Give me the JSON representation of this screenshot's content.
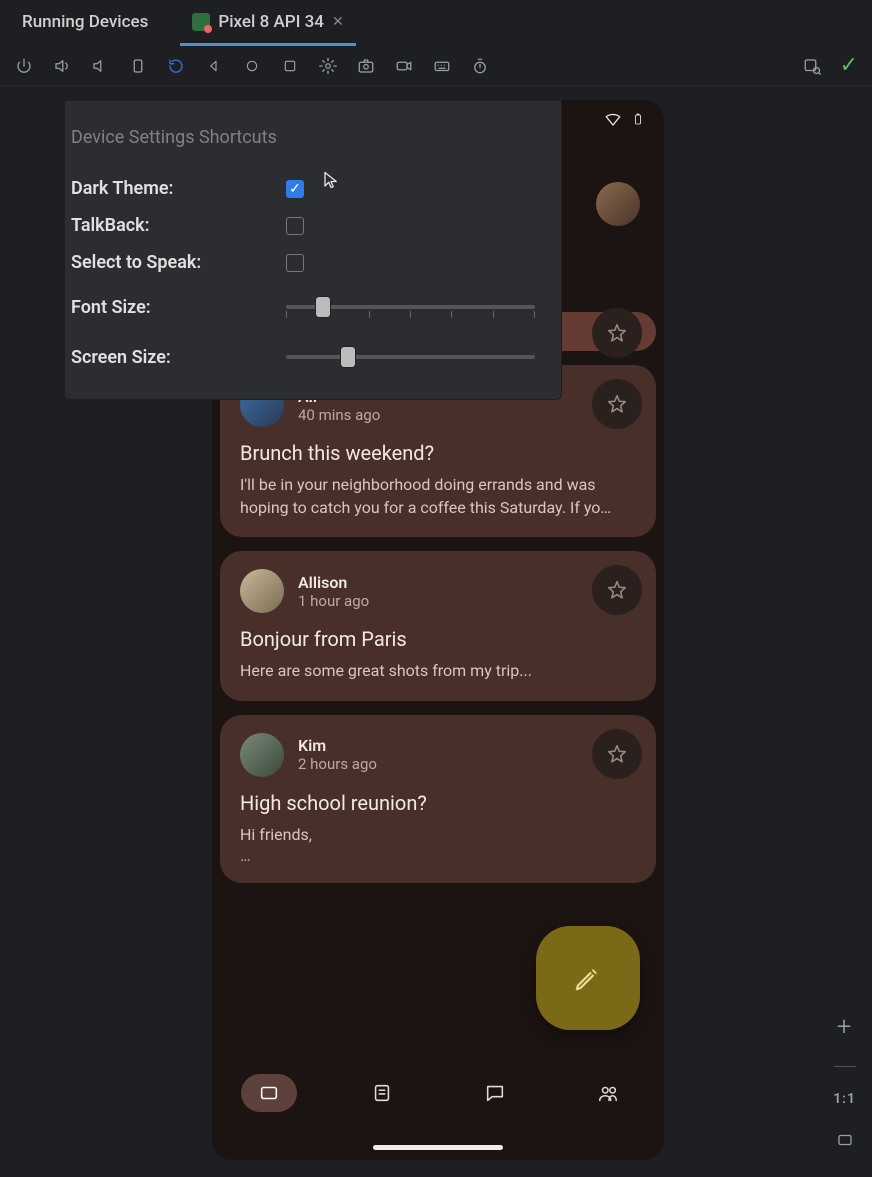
{
  "tabs": {
    "running_devices_label": "Running Devices",
    "device_tab_label": "Pixel 8 API 34"
  },
  "toolbar_icons": [
    "power-icon",
    "volume-up-icon",
    "volume-down-icon",
    "rotate-left-icon",
    "rotate-right-icon",
    "back-icon",
    "home-icon",
    "overview-icon",
    "settings-icon",
    "screenshot-icon",
    "record-icon",
    "keyboard-icon",
    "more-icon"
  ],
  "popover": {
    "title": "Device Settings Shortcuts",
    "dark_theme_label": "Dark Theme:",
    "dark_theme_checked": true,
    "talkback_label": "TalkBack:",
    "talkback_checked": false,
    "select_to_speak_label": "Select to Speak:",
    "select_to_speak_checked": false,
    "font_size_label": "Font Size:",
    "font_size_value_percent": 15,
    "font_size_ticks": 7,
    "screen_size_label": "Screen Size:",
    "screen_size_value_percent": 25,
    "screen_size_ticks": 0
  },
  "phone": {
    "status": {
      "wifi": true,
      "battery": true
    },
    "card_peek_ellipsis": "…",
    "cards": [
      {
        "sender": "Ali",
        "time": "40 mins ago",
        "subject": "Brunch this weekend?",
        "body": "I'll be in your neighborhood doing errands and was hoping to catch you for a coffee this Saturday. If yo…",
        "avatar_class": "a"
      },
      {
        "sender": "Allison",
        "time": "1 hour ago",
        "subject": "Bonjour from Paris",
        "body": "Here are some great shots from my trip...",
        "avatar_class": "b"
      },
      {
        "sender": "Kim",
        "time": "2 hours ago",
        "subject": "High school reunion?",
        "body": "Hi friends,",
        "body2": "…",
        "avatar_class": "c"
      }
    ],
    "nav": [
      "inbox",
      "articles",
      "chat",
      "people"
    ],
    "nav_selected": 0
  },
  "right_tools": {
    "zoom_in": "+",
    "ratio": "1:1"
  }
}
